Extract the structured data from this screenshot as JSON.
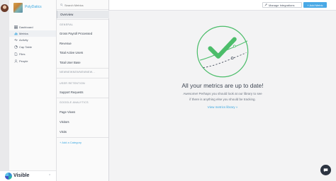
{
  "company": {
    "name": "PolyDatics"
  },
  "nav": {
    "items": [
      {
        "label": "Dashboard",
        "icon": "dashboard-icon"
      },
      {
        "label": "Metrics",
        "icon": "metrics-icon",
        "active": true
      },
      {
        "label": "Activity",
        "icon": "activity-icon"
      },
      {
        "label": "Cap Table",
        "icon": "cap-table-icon"
      },
      {
        "label": "Files",
        "icon": "files-icon"
      },
      {
        "label": "People",
        "icon": "people-icon"
      }
    ]
  },
  "brand": {
    "name": "Visible"
  },
  "metrics_panel": {
    "search_placeholder": "Search Metrics",
    "overview_label": "Overview",
    "general_header": "GENERAL",
    "general_items": [
      "Gross Payroll Processed",
      "Revenue",
      "Total Active Users",
      "Total User Base"
    ],
    "newsection_header": "NEWNEWNEWNEWNEW...",
    "user_retention_header": "USER RETENTION",
    "user_retention_items": [
      "Support Requests"
    ],
    "google_analytics_header": "GOOGLE ANALYTICS",
    "google_analytics_items": [
      "Page Views",
      "Visitors",
      "Visits"
    ],
    "add_category_label": "+ Add a Category"
  },
  "toolbar": {
    "manage_integrations_label": "Manage Integrations",
    "add_metric_label": "+ Add Metric"
  },
  "empty_state": {
    "title": "All your metrics are up to date!",
    "description_line1": "Awesome! Perhaps you should look at our library to see",
    "description_line2": "if there is anything else you should be tracking.",
    "link_label": "View metrics library »"
  },
  "colors": {
    "accent": "#49a9e6",
    "success": "#4cbd6a",
    "link": "#3aa7e0"
  }
}
